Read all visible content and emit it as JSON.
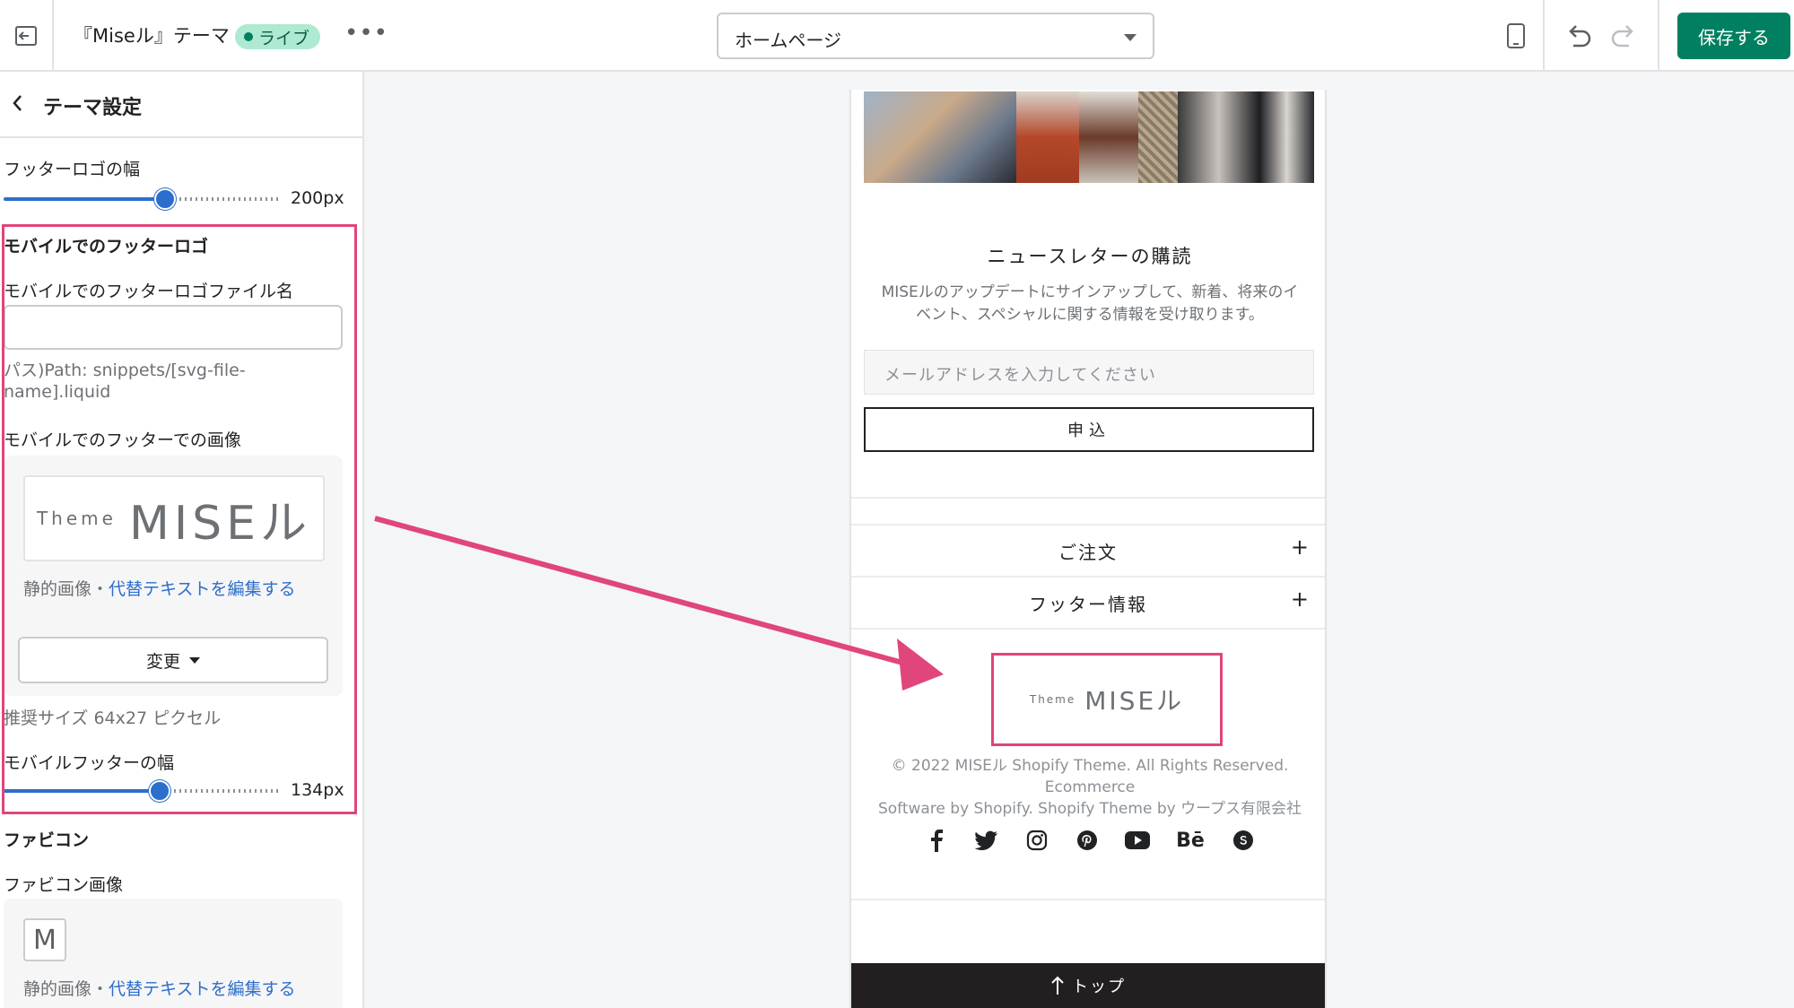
{
  "topbar": {
    "theme_name": "『Miseル』テーマ",
    "live_badge": "ライブ",
    "more": "•••",
    "page_selector": "ホームページ",
    "save_label": "保存する"
  },
  "sidebar": {
    "title": "テーマ設定",
    "footer_logo_width_label": "フッターロゴの幅",
    "footer_logo_width_value": "200px",
    "footer_logo_width_fraction": 0.58,
    "mobile_footer_logo_heading": "モバイルでのフッターロゴ",
    "mobile_footer_logo_filename_label": "モバイルでのフッターロゴファイル名",
    "mobile_footer_logo_filename_value": "",
    "path_hint_line1": "パス)Path: snippets/[svg-file-",
    "path_hint_line2": "name].liquid",
    "mobile_footer_image_label": "モバイルでのフッターでの画像",
    "logo_small": "Theme",
    "logo_big": "MISEル",
    "static_image": "静的画像",
    "caption_sep": "・",
    "edit_alt_text": "代替テキストを編集する",
    "change_label": "変更",
    "recommended_size": "推奨サイズ 64x27 ピクセル",
    "mobile_footer_width_label": "モバイルフッターの幅",
    "mobile_footer_width_value": "134px",
    "mobile_footer_width_fraction": 0.56,
    "favicon_heading": "ファビコン",
    "favicon_image_label": "ファビコン画像",
    "favicon_letter": "M",
    "favicon_static_image": "静的画像",
    "favicon_edit_alt_text": "代替テキストを編集する"
  },
  "preview": {
    "newsletter_title": "ニュースレターの購読",
    "newsletter_desc_line1": "MISEルのアップデートにサインアップして、新着、将来のイ",
    "newsletter_desc_line2": "ベント、スペシャルに関する情報を受け取ります。",
    "email_placeholder": "メールアドレスを入力してください",
    "submit_label": "申込",
    "accordion": [
      {
        "label": "ご注文",
        "plus": "+"
      },
      {
        "label": "フッター情報",
        "plus": "+"
      }
    ],
    "footer_logo_small": "Theme",
    "footer_logo_big": "MISEル",
    "copyright_line1": "© 2022 MISEル Shopify Theme. All Rights Reserved. Ecommerce",
    "copyright_line2": "Software by Shopify. Shopify Theme by ウープス有限会社",
    "social_icons": [
      "facebook-icon",
      "twitter-icon",
      "instagram-icon",
      "pinterest-icon",
      "youtube-icon",
      "behance-icon",
      "skype-icon"
    ],
    "behance_text": "Bē",
    "top_label": "トップ"
  },
  "colors": {
    "accent_pink": "#e0457b",
    "save_green": "#008060",
    "slider_blue": "#2c6ecb",
    "footer_dark": "#231f20"
  }
}
